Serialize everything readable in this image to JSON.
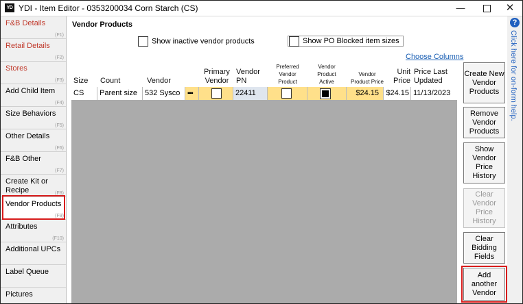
{
  "window": {
    "app_icon": "YD",
    "title": "YDI - Item Editor - 0353200034 Corn Starch (CS)",
    "minimize": "—",
    "close": "✕"
  },
  "sidebar": {
    "items": [
      {
        "label": "F&B Details",
        "key": "(F1)",
        "style": "red"
      },
      {
        "label": "Retail Details",
        "key": "(F2)",
        "style": "red"
      },
      {
        "label": "Stores",
        "key": "(F3)",
        "style": "red"
      },
      {
        "label": "Add Child Item",
        "key": "(F4)",
        "style": "normal"
      },
      {
        "label": "Size Behaviors",
        "key": "(F5)",
        "style": "normal"
      },
      {
        "label": "Other Details",
        "key": "(F6)",
        "style": "normal"
      },
      {
        "label": "F&B Other",
        "key": "(F7)",
        "style": "normal"
      },
      {
        "label": "Create Kit or Recipe",
        "key": "(F8)",
        "style": "normal"
      },
      {
        "label": "Vendor Products",
        "key": "(F9)",
        "style": "selected"
      },
      {
        "label": "Attributes",
        "key": "(F10)",
        "style": "normal"
      },
      {
        "label": "Additional UPCs",
        "key": "",
        "style": "normal"
      },
      {
        "label": "Label Queue",
        "key": "",
        "style": "normal"
      },
      {
        "label": "Pictures",
        "key": "",
        "style": "normal"
      }
    ]
  },
  "main": {
    "title": "Vendor Products",
    "show_inactive_label": "Show inactive vendor products",
    "show_blocked_label": "Show PO Blocked item sizes",
    "choose_columns": "Choose Columns"
  },
  "grid": {
    "headers": {
      "size": "Size",
      "count": "Count",
      "vendor": "Vendor",
      "primary_vendor": "Primary Vendor",
      "vendor_pn": "Vendor PN",
      "preferred": "Preferred Vendor Product",
      "active": "Vendor Product Active",
      "vendor_price": "Vendor Product Price",
      "unit_price": "Unit Price",
      "price_updated": "Price Last Updated"
    },
    "rows": [
      {
        "size": "CS",
        "count": "Parent size",
        "vendor": "532 Sysco",
        "ellipsis": "▪▪▪",
        "primary_vendor": false,
        "vendor_pn": "22411",
        "preferred": false,
        "active": true,
        "vendor_price": "$24.15",
        "unit_price": "$24.15",
        "price_updated": "11/13/2023"
      }
    ]
  },
  "buttons": {
    "create": "Create New Vendor Products",
    "remove": "Remove Vendor Products",
    "history": "Show Vendor Price History",
    "clear_history": "Clear Vendor Price History",
    "clear_bidding": "Clear Bidding Fields",
    "add_vendor": "Add another Vendor"
  },
  "help": {
    "icon": "?",
    "text": "Click here for on-form help."
  },
  "colors": {
    "highlight_outline": "#d81b1b",
    "yellow_cell": "#ffe08a",
    "link": "#1a5fb4",
    "help_blue": "#1f5fbf"
  }
}
